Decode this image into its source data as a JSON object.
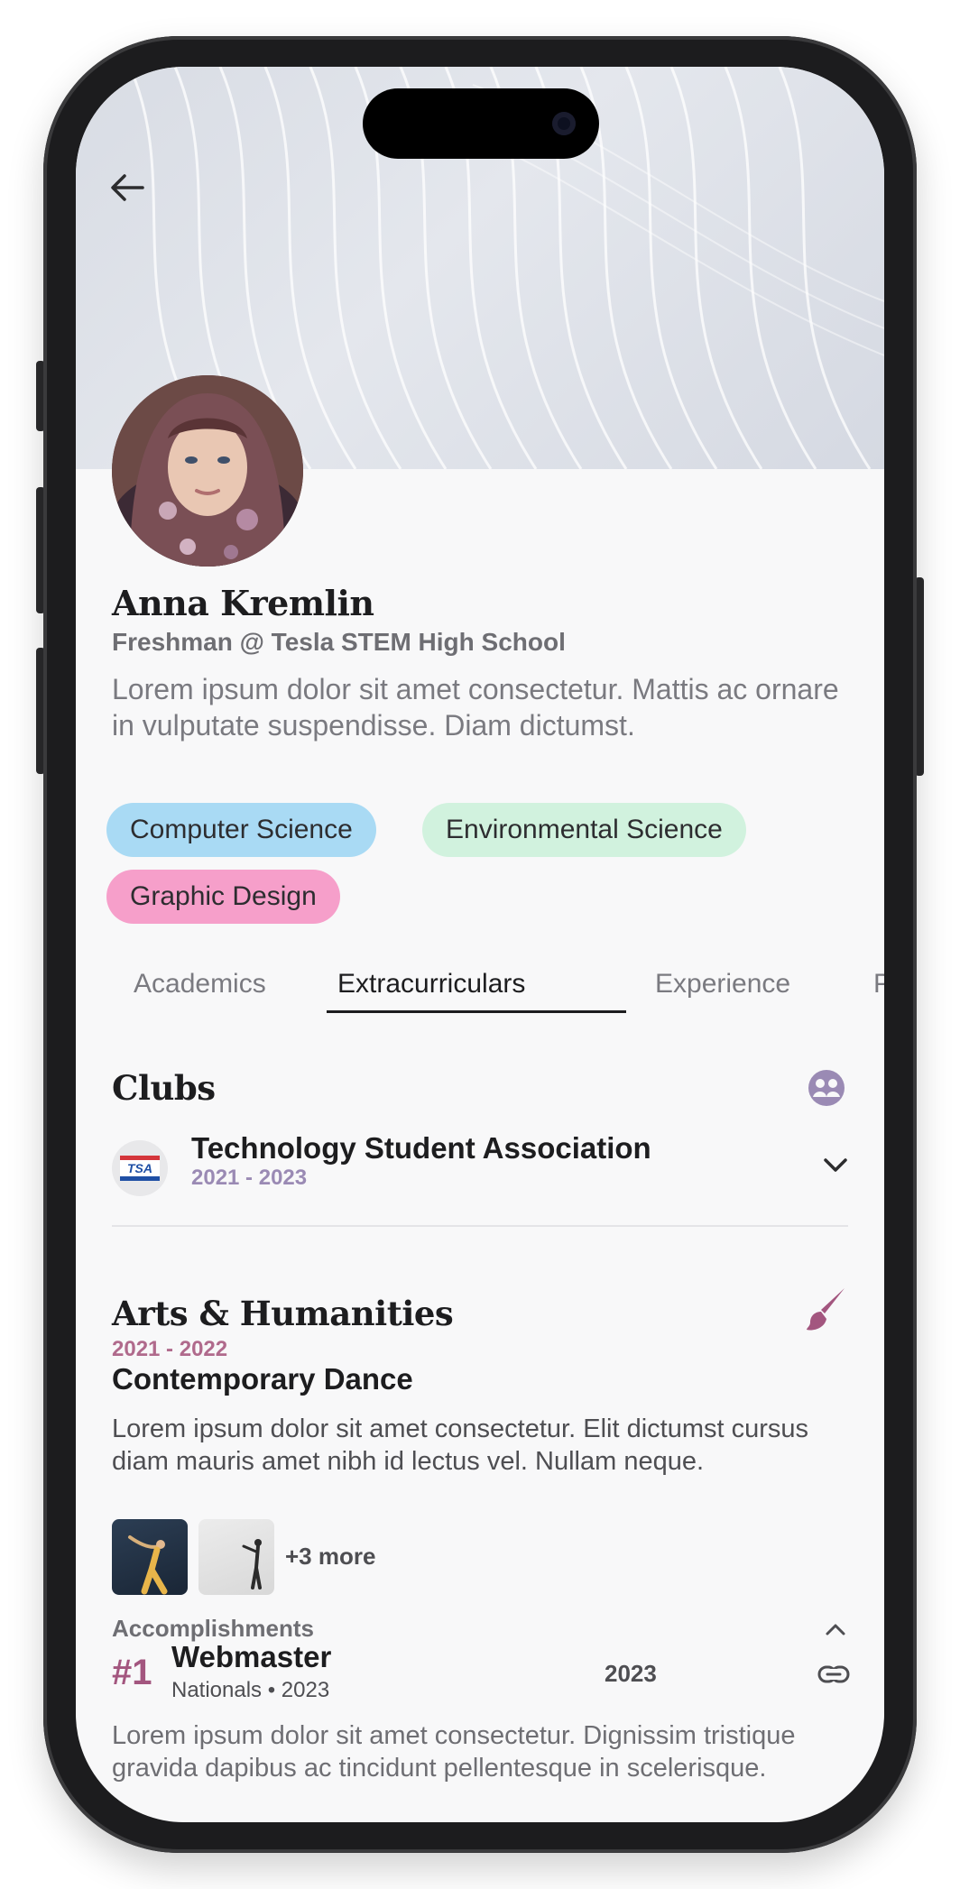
{
  "profile": {
    "name": "Anna Kremlin",
    "subtitle": "Freshman @ Tesla STEM High School",
    "bio": "Lorem ipsum dolor sit amet consectetur. Mattis ac ornare in vulputate suspendisse. Diam dictumst."
  },
  "interests": [
    {
      "label": "Computer Science",
      "color": "#a9daf4"
    },
    {
      "label": "Environmental Science",
      "color": "#d1f2de"
    },
    {
      "label": "Graphic Design",
      "color": "#f69fca"
    }
  ],
  "tabs": [
    {
      "label": "Academics",
      "active": false
    },
    {
      "label": "Extracurriculars",
      "active": true
    },
    {
      "label": "Experience",
      "active": false
    },
    {
      "label": "P",
      "active": false
    }
  ],
  "clubs": {
    "title": "Clubs",
    "icon": "group-icon",
    "items": [
      {
        "name": "Technology Student Association",
        "years": "2021 - 2023",
        "logo_text": "TSA"
      }
    ]
  },
  "arts": {
    "title": "Arts & Humanities",
    "icon": "paintbrush-icon",
    "entry": {
      "years": "2021 - 2022",
      "title": "Contemporary Dance",
      "description": "Lorem ipsum dolor sit amet consectetur. Elit dictumst cursus diam mauris amet nibh id lectus vel. Nullam neque.",
      "more_label": "+3 more"
    }
  },
  "accomplishments": {
    "header": "Accomplishments",
    "items": [
      {
        "rank": "#1",
        "title": "Webmaster",
        "meta": "Nationals • 2023",
        "year": "2023",
        "description": "Lorem ipsum dolor sit amet consectetur. Dignissim tristique gravida dapibus ac tincidunt pellentesque in scelerisque."
      }
    ]
  },
  "colors": {
    "accent_purple": "#9a8ab4",
    "accent_rose": "#a3567f",
    "background": "#f8f8f9"
  }
}
